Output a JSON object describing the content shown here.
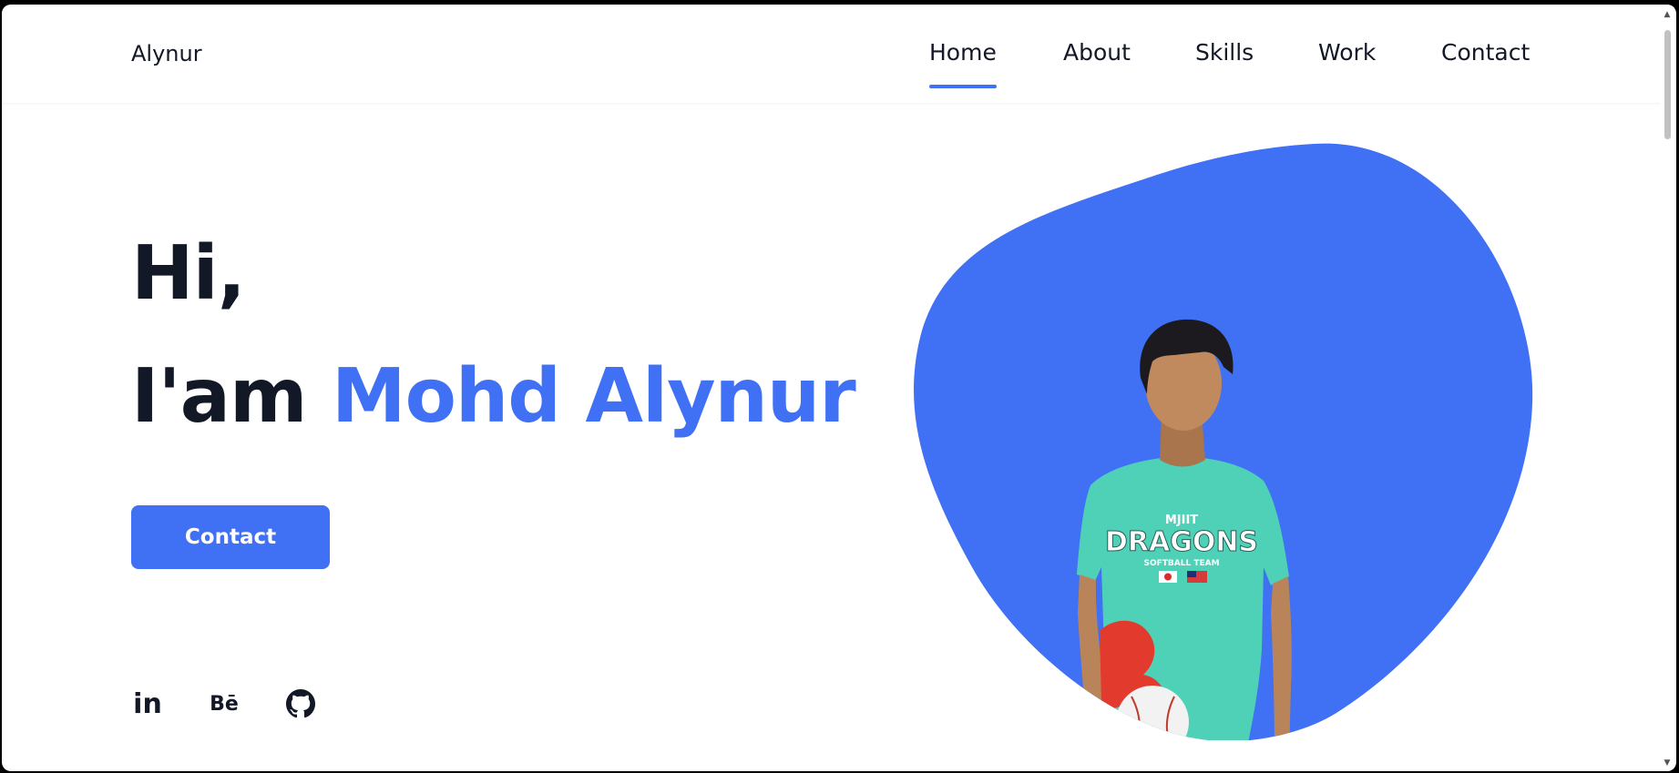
{
  "header": {
    "logo": "Alynur",
    "nav": [
      {
        "label": "Home",
        "active": true
      },
      {
        "label": "About",
        "active": false
      },
      {
        "label": "Skills",
        "active": false
      },
      {
        "label": "Work",
        "active": false
      },
      {
        "label": "Contact",
        "active": false
      }
    ]
  },
  "hero": {
    "greeting": "Hi,",
    "intro_prefix": "I'am",
    "name": "Mohd Alynur",
    "contact_button": "Contact",
    "photo_alt": "Portrait of Mohd Alynur",
    "shirt_text": "DRAGONS",
    "shirt_subtext": "MJIIT",
    "shirt_team": "SOFTBALL TEAM"
  },
  "social": {
    "linkedin_label": "in",
    "behance_label": "Bē",
    "github_icon": "github-icon"
  },
  "colors": {
    "accent": "#4070f4",
    "text": "#121826",
    "shirt": "#4fd1b8"
  }
}
